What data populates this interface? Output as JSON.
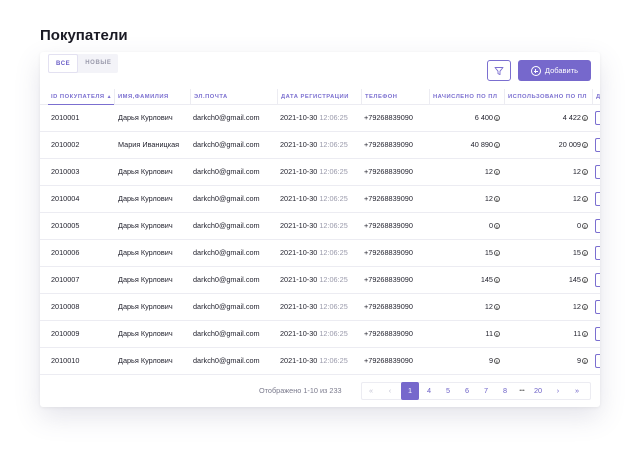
{
  "page": {
    "title": "Покупатели"
  },
  "tabs": [
    {
      "label": "ВСЕ",
      "active": true
    },
    {
      "label": "НОВЫЕ",
      "active": false
    }
  ],
  "toolbar": {
    "filter_icon": "filter-icon",
    "add_label": "Добавить",
    "add_icon": "plus-circle-icon",
    "accent_color": "#7668cc"
  },
  "table": {
    "columns": [
      "ID ПОКУПАТЕЛЯ",
      "ИМЯ,ФАМИЛИЯ",
      "ЭЛ.ПОЧТА",
      "ДАТА РЕГИСТРАЦИИ",
      "ТЕЛЕФОН",
      "НАЧИСЛЕНО ПО ПЛ",
      "ИСПОЛЬЗОВАНО ПО ПЛ",
      "Д"
    ],
    "rows": [
      {
        "id": "2010001",
        "name": "Дарья Курлович",
        "email": "darkch0@gmail.com",
        "date": "2021-10-30",
        "time": "12:06:25",
        "phone": "+79268839090",
        "accrued": "6 400",
        "used": "4 422"
      },
      {
        "id": "2010002",
        "name": "Мария Иваницкая",
        "email": "darkch0@gmail.com",
        "date": "2021-10-30",
        "time": "12:06:25",
        "phone": "+79268839090",
        "accrued": "40 890",
        "used": "20 009"
      },
      {
        "id": "2010003",
        "name": "Дарья Курлович",
        "email": "darkch0@gmail.com",
        "date": "2021-10-30",
        "time": "12:06:25",
        "phone": "+79268839090",
        "accrued": "12",
        "used": "12"
      },
      {
        "id": "2010004",
        "name": "Дарья Курлович",
        "email": "darkch0@gmail.com",
        "date": "2021-10-30",
        "time": "12:06:25",
        "phone": "+79268839090",
        "accrued": "12",
        "used": "12"
      },
      {
        "id": "2010005",
        "name": "Дарья Курлович",
        "email": "darkch0@gmail.com",
        "date": "2021-10-30",
        "time": "12:06:25",
        "phone": "+79268839090",
        "accrued": "0",
        "used": "0"
      },
      {
        "id": "2010006",
        "name": "Дарья Курлович",
        "email": "darkch0@gmail.com",
        "date": "2021-10-30",
        "time": "12:06:25",
        "phone": "+79268839090",
        "accrued": "15",
        "used": "15"
      },
      {
        "id": "2010007",
        "name": "Дарья Курлович",
        "email": "darkch0@gmail.com",
        "date": "2021-10-30",
        "time": "12:06:25",
        "phone": "+79268839090",
        "accrued": "145",
        "used": "145"
      },
      {
        "id": "2010008",
        "name": "Дарья Курлович",
        "email": "darkch0@gmail.com",
        "date": "2021-10-30",
        "time": "12:06:25",
        "phone": "+79268839090",
        "accrued": "12",
        "used": "12"
      },
      {
        "id": "2010009",
        "name": "Дарья Курлович",
        "email": "darkch0@gmail.com",
        "date": "2021-10-30",
        "time": "12:06:25",
        "phone": "+79268839090",
        "accrued": "11",
        "used": "11"
      },
      {
        "id": "2010010",
        "name": "Дарья Курлович",
        "email": "darkch0@gmail.com",
        "date": "2021-10-30",
        "time": "12:06:25",
        "phone": "+79268839090",
        "accrued": "9",
        "used": "9"
      }
    ],
    "currency_icon": "points-coin-icon",
    "currency_glyph": "Б"
  },
  "pagination": {
    "info": "Отображено 1-10 из 233",
    "first": "«",
    "prev": "‹",
    "pages": [
      "1",
      "4",
      "5",
      "6",
      "7",
      "8",
      "•••",
      "20"
    ],
    "active_page": "1",
    "next": "›",
    "last": "»"
  }
}
